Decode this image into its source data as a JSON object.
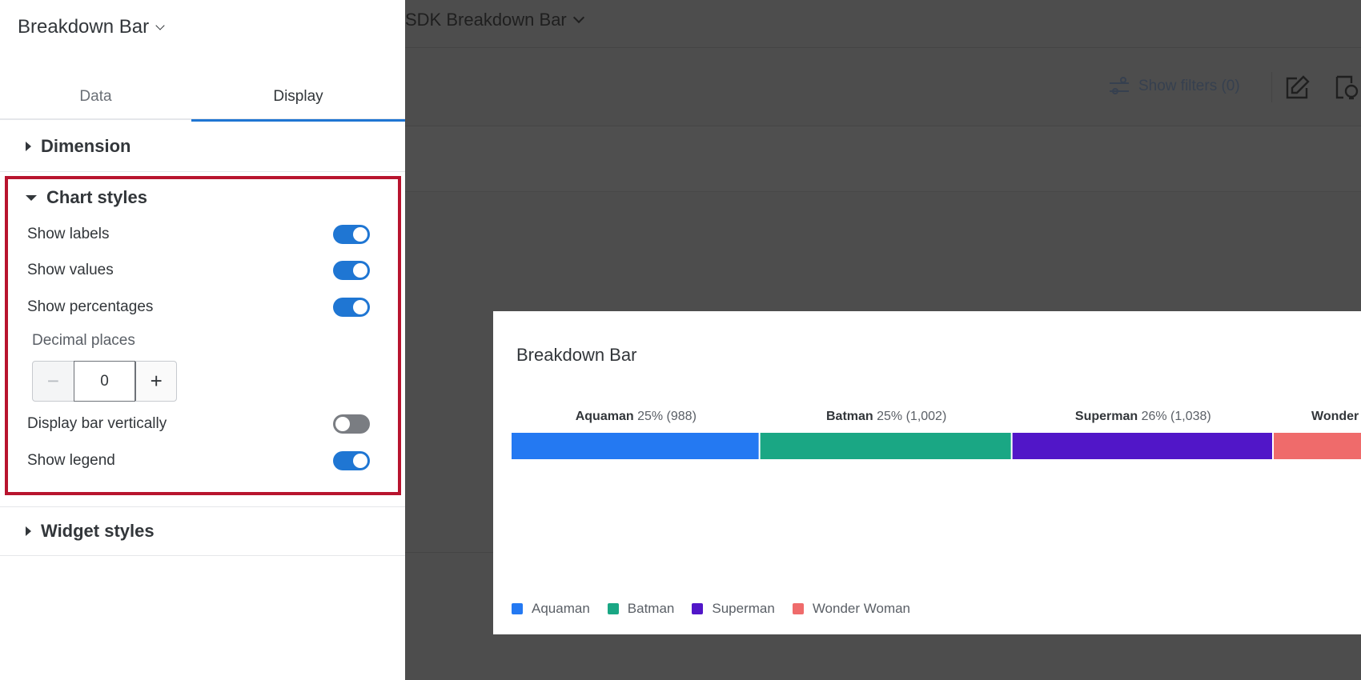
{
  "panel": {
    "title": "Breakdown Bar",
    "tabs": [
      {
        "label": "Data",
        "active": false
      },
      {
        "label": "Display",
        "active": true
      }
    ],
    "sections": {
      "dimension": "Dimension",
      "chart_styles": "Chart styles",
      "widget_styles": "Widget styles"
    },
    "chart_styles": {
      "show_labels": {
        "label": "Show labels",
        "on": true
      },
      "show_values": {
        "label": "Show values",
        "on": true
      },
      "show_percentages": {
        "label": "Show percentages",
        "on": true
      },
      "decimal_places": {
        "label": "Decimal places",
        "value": "0",
        "minus": "−",
        "plus": "+"
      },
      "display_bar_vertically": {
        "label": "Display bar vertically",
        "on": false
      },
      "show_legend": {
        "label": "Show legend",
        "on": true
      }
    }
  },
  "background": {
    "title": "SDK Breakdown Bar",
    "show_filters": "Show filters (0)"
  },
  "widget": {
    "title": "Breakdown Bar"
  },
  "colors": {
    "accent": "#1f76d3",
    "highlight_border": "#b8142e",
    "aquaman": "#2479f2",
    "batman": "#1aa784",
    "superman": "#5116c8",
    "wonder_woman": "#ef6b6b"
  },
  "chart_data": {
    "type": "bar",
    "orientation": "horizontal-stacked",
    "categories": [
      "Aquaman",
      "Batman",
      "Superman",
      "Wonder Woman"
    ],
    "values": [
      988,
      1002,
      1038,
      null
    ],
    "percentages": [
      25,
      25,
      26,
      null
    ],
    "labels": [
      {
        "name": "Aquaman",
        "detail": "25% (988)"
      },
      {
        "name": "Batman",
        "detail": "25% (1,002)"
      },
      {
        "name": "Superman",
        "detail": "26% (1,038)"
      },
      {
        "name": "Wonder",
        "detail": ""
      }
    ],
    "legend": [
      "Aquaman",
      "Batman",
      "Superman",
      "Wonder Woman"
    ],
    "legend_position": "bottom-left"
  }
}
